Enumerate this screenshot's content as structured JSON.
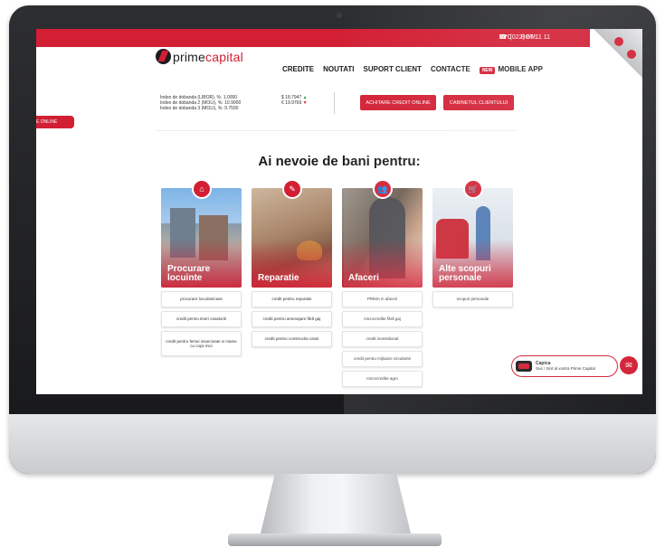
{
  "topbar": {
    "lang_ru": "РУС",
    "lang_ro": "ROM",
    "phone": "(022) 87 11 11"
  },
  "logo": {
    "part1": "prime",
    "part2": "capital"
  },
  "nav": {
    "items": [
      "CREDITE",
      "NOUTATI",
      "SUPORT CLIENT",
      "CONTACTE"
    ],
    "new_badge": "NEW",
    "mobile_app": "MOBILE APP"
  },
  "indexes": [
    "Index de dobanda (LIBOR), %: 1.0000",
    "Index de dobanda 2 (MOLI), %: 10.9000",
    "Index de dobanda 3 (MOLI), %: 9.7500"
  ],
  "rates": [
    {
      "value": "$ 18.7947",
      "dir": "▲"
    },
    {
      "value": "€ 19.9769",
      "dir": "▼"
    }
  ],
  "buttons": {
    "achitare": "ACHITARE CREDIT ONLINE",
    "cabinet": "CABINETUL CLIENTULUI"
  },
  "side_online": "E ONLINE",
  "headline": "Ai nevoie de bani pentru:",
  "cards": [
    {
      "title": "Procurare locuinte",
      "icon": "home-icon",
      "glyph": "⌂",
      "subs": [
        "procurare locuinte/case",
        "credit pentru tineri casatoriti",
        "credit pentru femei insarcinate si mame cu copii mici"
      ]
    },
    {
      "title": "Reparatie",
      "icon": "brush-icon",
      "glyph": "✎",
      "subs": [
        "credit pentru reparatie",
        "credit pentru amenajare fără gaj",
        "credit pentru constructia casei"
      ]
    },
    {
      "title": "Afaceri",
      "icon": "people-icon",
      "glyph": "👥",
      "subs": [
        "PRIMA in afaceri",
        "microcredite fără gaj",
        "credit investitional",
        "credit pentru mijloace circulante",
        "microcredite agro"
      ]
    },
    {
      "title": "Alte scopuri personale",
      "icon": "cart-icon",
      "glyph": "🛒",
      "subs": [
        "scopuri personale"
      ]
    }
  ],
  "chat": {
    "name": "Capica",
    "message": "Sus ! Sint al vostra Prime Capital"
  },
  "colors": {
    "brand": "#d21f34",
    "dark": "#1d1d1f"
  }
}
